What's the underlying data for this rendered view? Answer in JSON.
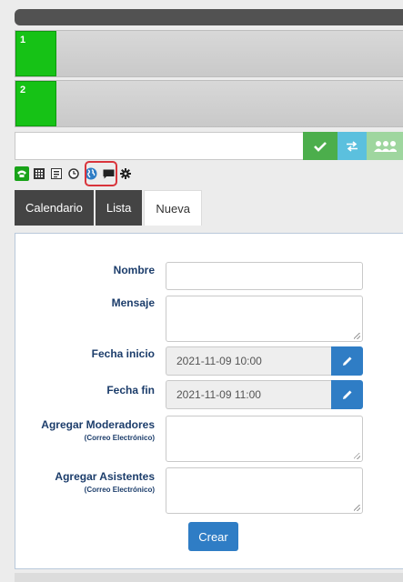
{
  "lines": [
    {
      "number": "1",
      "color": "#16c216"
    },
    {
      "number": "2",
      "color": "#16c216"
    }
  ],
  "dialbar": {
    "input_value": "",
    "buttons": [
      {
        "icon": "check-icon",
        "color": "#4cae4c"
      },
      {
        "icon": "transfer-icon",
        "color": "#5bc0de"
      },
      {
        "icon": "conference-icon",
        "color": "#9fd69f"
      }
    ]
  },
  "toolbar": {
    "icons": [
      "phone-icon",
      "keypad-icon",
      "contacts-icon",
      "clock-icon",
      "globe-icon",
      "chat-icon",
      "settings-icon"
    ],
    "selected": "globe-icon"
  },
  "tabs": [
    {
      "label": "Calendario",
      "active": false
    },
    {
      "label": "Lista",
      "active": false
    },
    {
      "label": "Nueva",
      "active": true
    }
  ],
  "form": {
    "nombre": {
      "label": "Nombre",
      "value": ""
    },
    "mensaje": {
      "label": "Mensaje",
      "value": ""
    },
    "fecha_inicio": {
      "label": "Fecha inicio",
      "value": "2021-11-09 10:00"
    },
    "fecha_fin": {
      "label": "Fecha fin",
      "value": "2021-11-09 11:00"
    },
    "moderadores": {
      "label": "Agregar Moderadores",
      "sublabel": "(Correo Electrónico)",
      "value": ""
    },
    "asistentes": {
      "label": "Agregar Asistentes",
      "sublabel": "(Correo Electrónico)",
      "value": ""
    },
    "submit_label": "Crear"
  },
  "colors": {
    "accent": "#2f7dc5",
    "label": "#1c3d6b",
    "line_active": "#16c216",
    "highlight": "#d9343b"
  }
}
